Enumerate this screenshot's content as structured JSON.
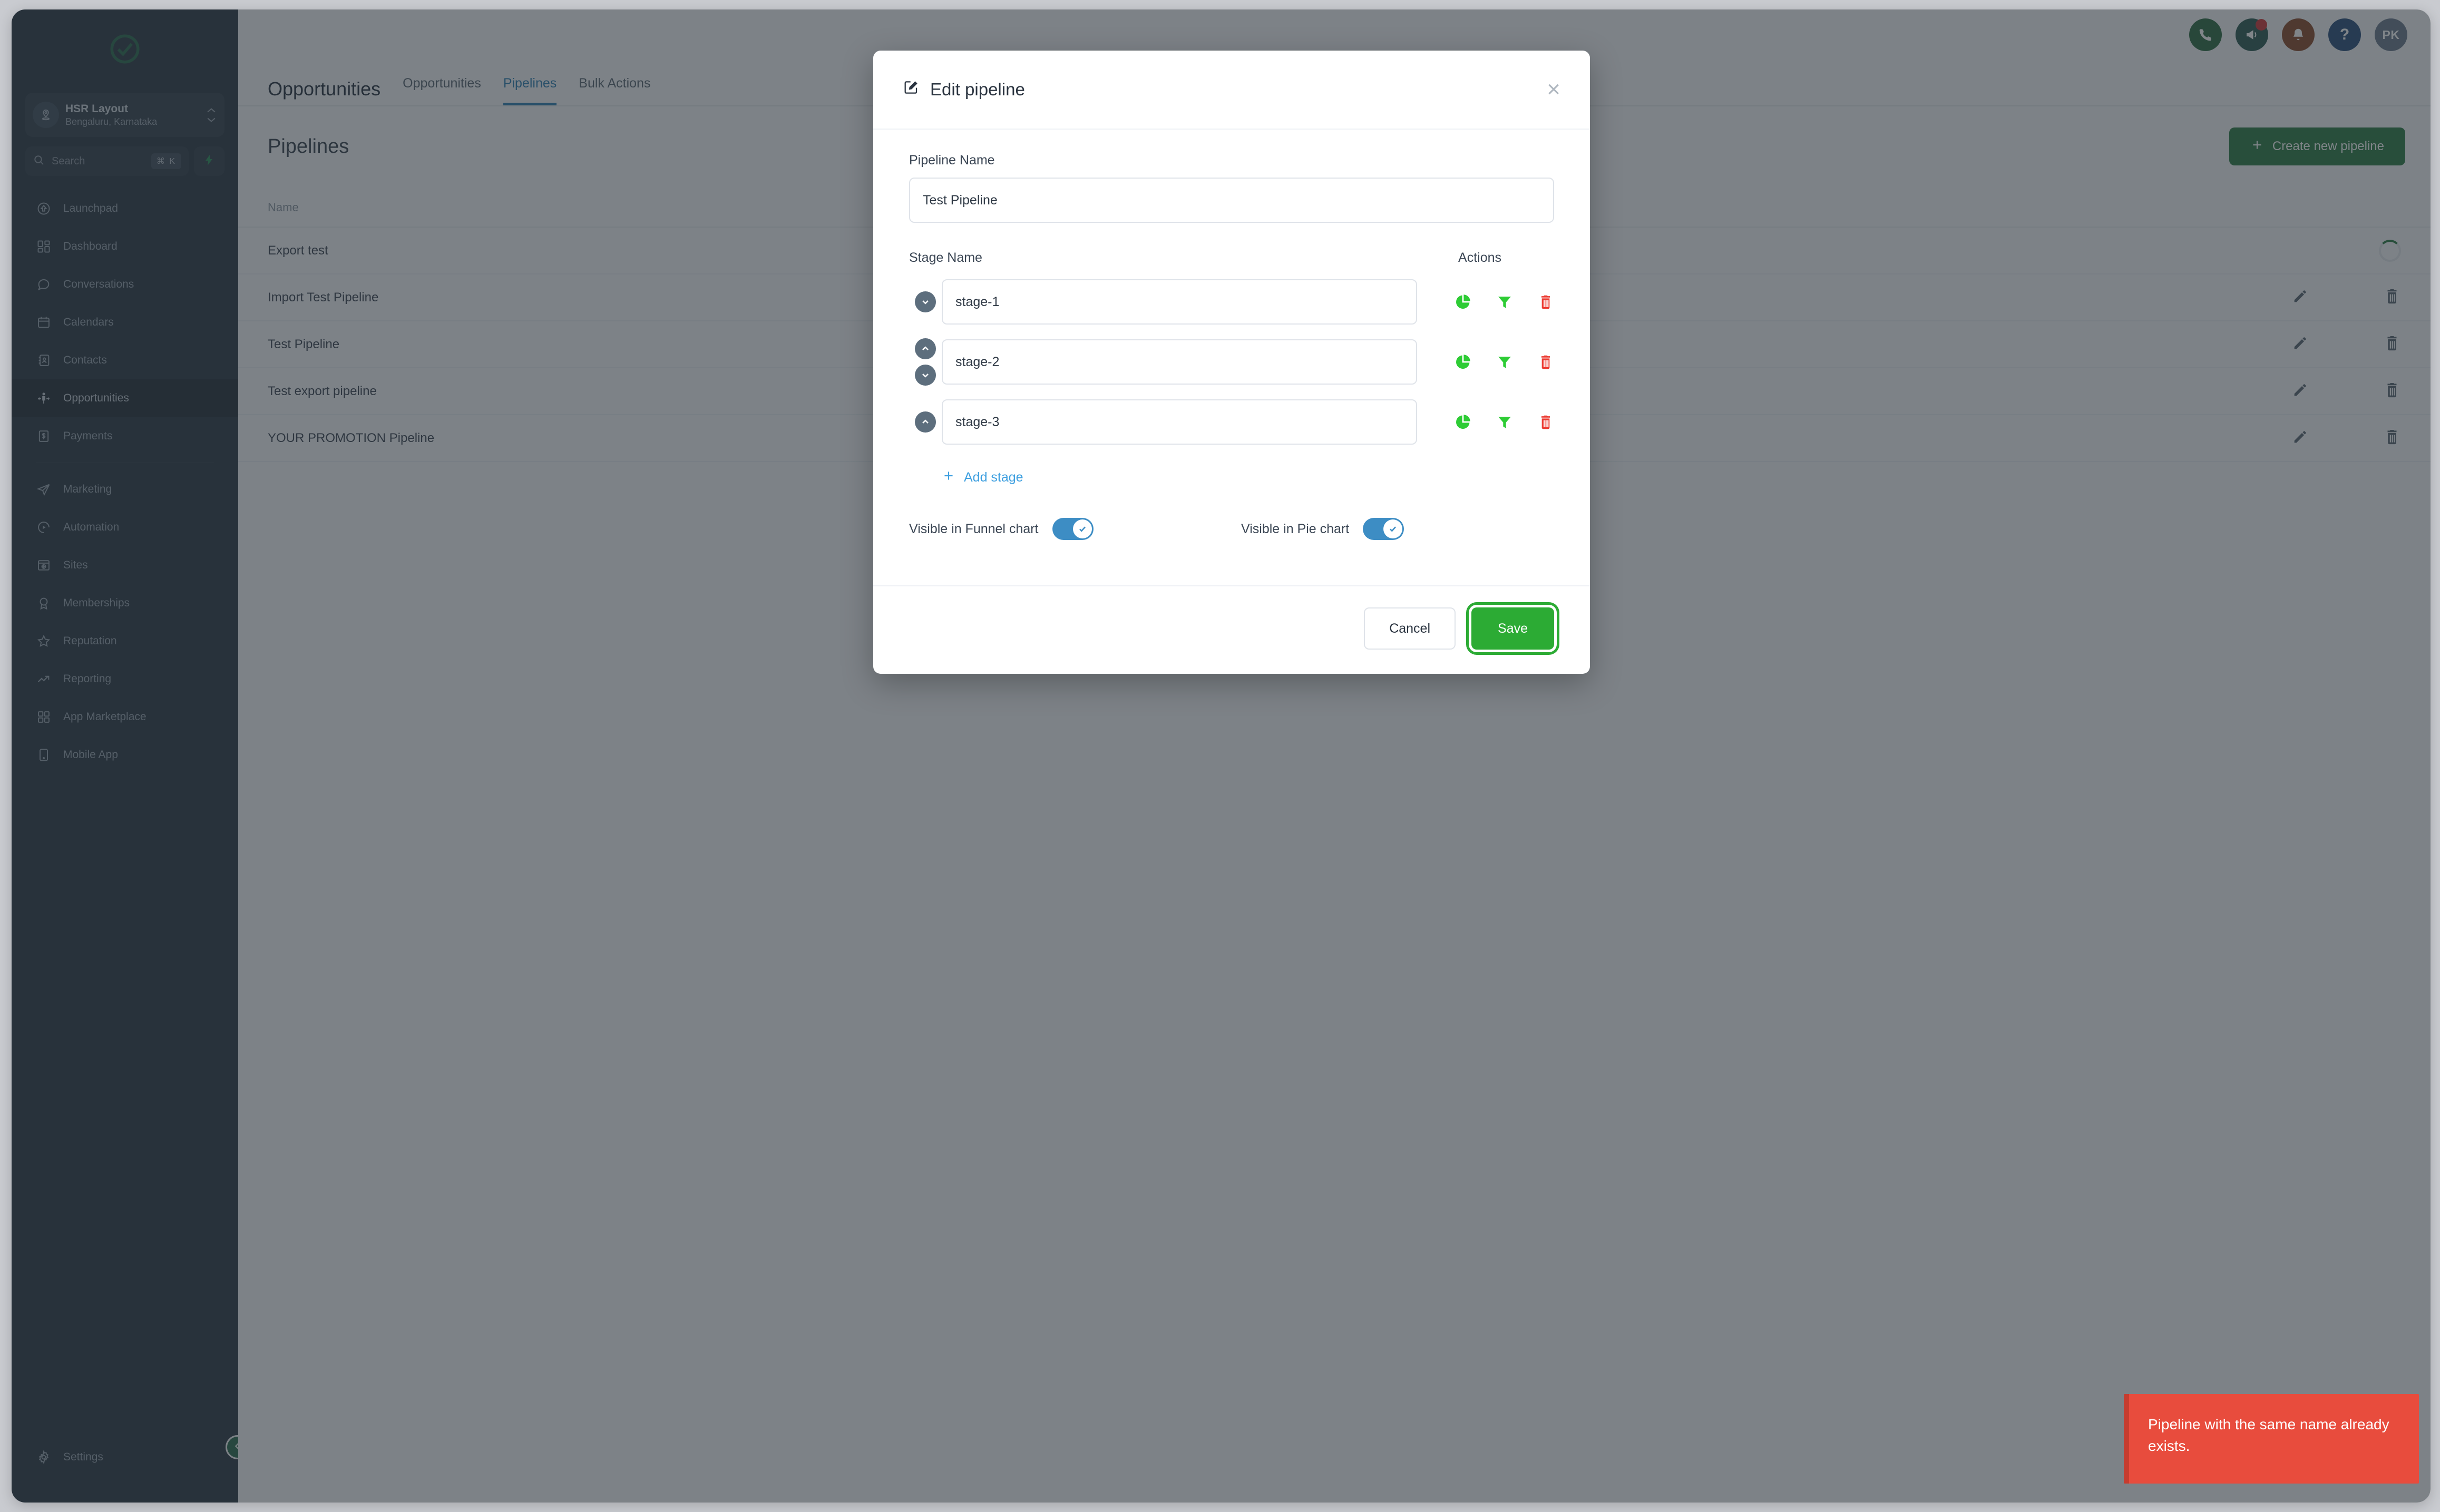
{
  "sidebar": {
    "logo": "check-circle-logo",
    "location": {
      "name": "HSR Layout",
      "sub": "Bengaluru, Karnataka",
      "icon": "location-pin-icon"
    },
    "search": {
      "placeholder": "Search",
      "shortcut": "⌘ K",
      "icon": "search-icon",
      "bolt": "bolt-icon"
    },
    "items": [
      {
        "label": "Launchpad",
        "icon": "rocket-home-icon",
        "active": false
      },
      {
        "label": "Dashboard",
        "icon": "dashboard-icon",
        "active": false
      },
      {
        "label": "Conversations",
        "icon": "chat-bubble-icon",
        "active": false
      },
      {
        "label": "Calendars",
        "icon": "calendar-icon",
        "active": false
      },
      {
        "label": "Contacts",
        "icon": "contacts-book-icon",
        "active": false
      },
      {
        "label": "Opportunities",
        "icon": "opportunities-icon",
        "active": true
      },
      {
        "label": "Payments",
        "icon": "payments-icon",
        "active": false
      }
    ],
    "items2": [
      {
        "label": "Marketing",
        "icon": "paper-plane-icon",
        "active": false
      },
      {
        "label": "Automation",
        "icon": "automation-icon",
        "active": false
      },
      {
        "label": "Sites",
        "icon": "sites-icon",
        "active": false
      },
      {
        "label": "Memberships",
        "icon": "badge-icon",
        "active": false
      },
      {
        "label": "Reputation",
        "icon": "star-icon",
        "active": false
      },
      {
        "label": "Reporting",
        "icon": "trend-up-icon",
        "active": false
      },
      {
        "label": "App Marketplace",
        "icon": "grid-icon",
        "active": false
      },
      {
        "label": "Mobile App",
        "icon": "mobile-icon",
        "active": false
      }
    ],
    "settings": {
      "label": "Settings",
      "icon": "gear-icon"
    },
    "collapse": {
      "icon": "chevron-left-icon"
    }
  },
  "topbar": {
    "icons": [
      {
        "name": "phone-icon",
        "color": "#2f6b43"
      },
      {
        "name": "megaphone-icon",
        "color": "#2f5b55",
        "badge": true
      },
      {
        "name": "bell-icon",
        "color": "#8a4a2c"
      },
      {
        "name": "help-icon",
        "color": "#2c4f7c",
        "glyph": "?"
      }
    ],
    "avatar": {
      "initials": "PK",
      "name": "user-avatar"
    }
  },
  "page": {
    "title": "Opportunities",
    "tabs": [
      {
        "label": "Opportunities",
        "active": false
      },
      {
        "label": "Pipelines",
        "active": true
      },
      {
        "label": "Bulk Actions",
        "active": false
      }
    ],
    "heading": "Pipelines",
    "create_button": "Create new pipeline",
    "table": {
      "columns": [
        "Name"
      ],
      "rows": [
        {
          "name": "Export test",
          "loading": true
        },
        {
          "name": "Import Test Pipeline",
          "loading": false
        },
        {
          "name": "Test Pipeline",
          "loading": false
        },
        {
          "name": "Test export pipeline",
          "loading": false
        },
        {
          "name": "YOUR PROMOTION Pipeline",
          "loading": false
        }
      ],
      "row_actions": {
        "edit": "pencil-icon",
        "delete": "trash-icon"
      }
    }
  },
  "modal": {
    "title": "Edit pipeline",
    "title_icon": "edit-square-icon",
    "close_icon": "close-icon",
    "pipeline_name_label": "Pipeline Name",
    "pipeline_name_value": "Test Pipeline",
    "pipeline_name_placeholder": "Pipeline Name",
    "stage_name_label": "Stage Name",
    "actions_label": "Actions",
    "stages": [
      {
        "value": "stage-1",
        "can_move_up": false,
        "can_move_down": true
      },
      {
        "value": "stage-2",
        "can_move_up": true,
        "can_move_down": true
      },
      {
        "value": "stage-3",
        "can_move_up": true,
        "can_move_down": false
      }
    ],
    "stage_actions": {
      "pie": "pie-chart-icon",
      "funnel": "funnel-icon",
      "delete": "trash-icon"
    },
    "add_stage": "Add stage",
    "toggles": [
      {
        "label": "Visible in Funnel chart",
        "on": true
      },
      {
        "label": "Visible in Pie chart",
        "on": true
      }
    ],
    "cancel": "Cancel",
    "save": "Save"
  },
  "toast": {
    "message": "Pipeline with the same name already exists.",
    "color": "#e84c3d"
  }
}
